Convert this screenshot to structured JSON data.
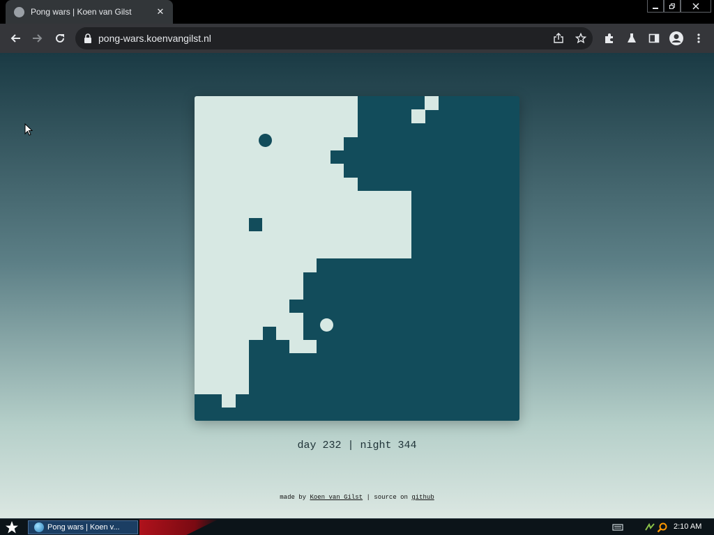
{
  "browser": {
    "tab_title": "Pong wars | Koen van Gilst",
    "url": "pong-wars.koenvangilst.nl"
  },
  "game": {
    "grid_size": 24,
    "day_color": "#d7e8e3",
    "night_color": "#124c5b",
    "day_ball_cell": [
      5.25,
      3.25
    ],
    "night_ball_cell": [
      9.75,
      16.9
    ],
    "day_cells_by_row": [
      [
        [
          0,
          11
        ],
        [
          17,
          17
        ]
      ],
      [
        [
          0,
          11
        ],
        [
          16,
          16
        ]
      ],
      [
        [
          0,
          11
        ]
      ],
      [
        [
          0,
          10
        ]
      ],
      [
        [
          0,
          9
        ]
      ],
      [
        [
          0,
          10
        ]
      ],
      [
        [
          0,
          11
        ]
      ],
      [
        [
          0,
          15
        ]
      ],
      [
        [
          0,
          15
        ]
      ],
      [
        [
          0,
          3
        ],
        [
          5,
          15
        ]
      ],
      [
        [
          0,
          15
        ]
      ],
      [
        [
          0,
          15
        ]
      ],
      [
        [
          0,
          8
        ]
      ],
      [
        [
          0,
          7
        ]
      ],
      [
        [
          0,
          7
        ]
      ],
      [
        [
          0,
          6
        ]
      ],
      [
        [
          0,
          7
        ]
      ],
      [
        [
          0,
          4
        ],
        [
          6,
          7
        ]
      ],
      [
        [
          0,
          3
        ],
        [
          7,
          8
        ]
      ],
      [
        [
          0,
          3
        ]
      ],
      [
        [
          0,
          3
        ]
      ],
      [
        [
          0,
          3
        ]
      ],
      [
        [
          2,
          2
        ]
      ],
      []
    ]
  },
  "score": {
    "text": "day 232 | night 344"
  },
  "credit": {
    "prefix": "made by ",
    "author": "Koen van Gilst",
    "middle": " | source on ",
    "source": "github"
  },
  "taskbar": {
    "task_label": "Pong wars | Koen v...",
    "clock": "2:10 AM"
  }
}
